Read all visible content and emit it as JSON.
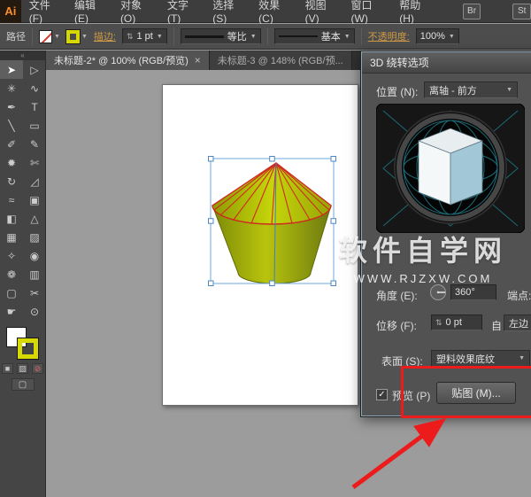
{
  "menubar": {
    "logo": "Ai",
    "items": [
      "文件(F)",
      "编辑(E)",
      "对象(O)",
      "文字(T)",
      "选择(S)",
      "效果(C)",
      "视图(V)",
      "窗口(W)",
      "帮助(H)"
    ],
    "bridge_button": "Br",
    "style_button": "St"
  },
  "controlbar": {
    "context": "路径",
    "stroke_link": "描边:",
    "stroke_width": "1 pt",
    "profile": "等比",
    "brush": "基本",
    "opacity_label": "不透明度:",
    "opacity": "100%"
  },
  "tabs": [
    {
      "label": "未标题-2* @ 100% (RGB/预览)",
      "close": "×"
    },
    {
      "label": "未标题-3 @ 148% (RGB/预..."
    }
  ],
  "tools": [
    {
      "name": "selection",
      "glyph": "➤"
    },
    {
      "name": "direct-selection",
      "glyph": "▷"
    },
    {
      "name": "magic-wand",
      "glyph": "✳"
    },
    {
      "name": "lasso",
      "glyph": "∿"
    },
    {
      "name": "pen",
      "glyph": "✒"
    },
    {
      "name": "type",
      "glyph": "T"
    },
    {
      "name": "line-segment",
      "glyph": "╲"
    },
    {
      "name": "rectangle",
      "glyph": "▭"
    },
    {
      "name": "paintbrush",
      "glyph": "✐"
    },
    {
      "name": "pencil",
      "glyph": "✎"
    },
    {
      "name": "blob-brush",
      "glyph": "✹"
    },
    {
      "name": "eraser",
      "glyph": "✄"
    },
    {
      "name": "rotate",
      "glyph": "↻"
    },
    {
      "name": "scale",
      "glyph": "◿"
    },
    {
      "name": "width",
      "glyph": "≈"
    },
    {
      "name": "free-transform",
      "glyph": "▣"
    },
    {
      "name": "shape-builder",
      "glyph": "◧"
    },
    {
      "name": "perspective-grid",
      "glyph": "△"
    },
    {
      "name": "mesh",
      "glyph": "▦"
    },
    {
      "name": "gradient",
      "glyph": "▨"
    },
    {
      "name": "eyedropper",
      "glyph": "✧"
    },
    {
      "name": "blend",
      "glyph": "◉"
    },
    {
      "name": "symbol-sprayer",
      "glyph": "❁"
    },
    {
      "name": "column-graph",
      "glyph": "▥"
    },
    {
      "name": "artboard",
      "glyph": "▢"
    },
    {
      "name": "slice",
      "glyph": "✂"
    },
    {
      "name": "hand",
      "glyph": "☛"
    },
    {
      "name": "zoom",
      "glyph": "⊙"
    }
  ],
  "dialog": {
    "title": "3D 绕转选项",
    "position_label": "位置 (N):",
    "position_value": "离轴 - 前方",
    "angle_label": "角度 (E):",
    "angle_value": "360°",
    "cap_label": "端点:",
    "offset_label": "位移 (F):",
    "offset_value": "0 pt",
    "offset_from": "自",
    "offset_edge": "左边",
    "surface_label": "表面 (S):",
    "surface_value": "塑料效果底纹",
    "preview": "预览 (P)",
    "map_button": "贴图 (M)..."
  },
  "watermark": {
    "title": "软件自学网",
    "url": "WWW.RJZXW.COM"
  },
  "icons": {
    "dropdown": "▼",
    "stepper": "⇅",
    "check": "✓",
    "collapse": "«",
    "color_btn": "■",
    "gradient_btn": "▨",
    "none_btn": "⊘",
    "screen_mode": "▢"
  },
  "colors": {
    "accent_red": "#ec1c1c",
    "stroke_yellow": "#d6da00",
    "cube_blue": "#a2c8d7"
  }
}
